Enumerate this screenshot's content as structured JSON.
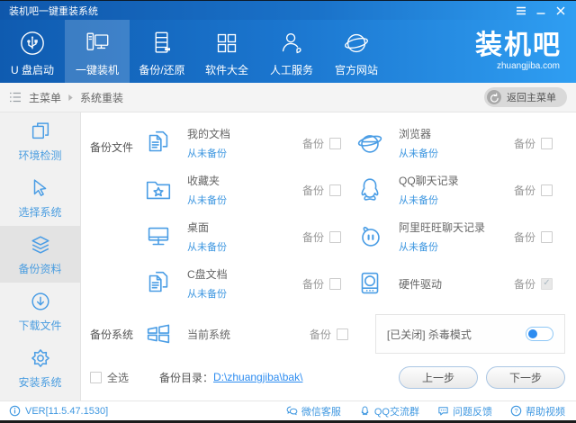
{
  "window": {
    "title": "装机吧一键重装系统",
    "controls": [
      {
        "id": "menu",
        "icon": "menu-icon"
      },
      {
        "id": "minimize",
        "icon": "minimize-icon"
      },
      {
        "id": "close",
        "icon": "close-icon"
      }
    ]
  },
  "nav": {
    "items": [
      {
        "id": "usb-boot",
        "icon": "usb-icon",
        "label": "U 盘启动",
        "active": false
      },
      {
        "id": "one-key-install",
        "icon": "computer-icon",
        "label": "一键装机",
        "active": true
      },
      {
        "id": "backup-restore",
        "icon": "server-icon",
        "label": "备份/还原",
        "active": false
      },
      {
        "id": "software-collection",
        "icon": "grid-icon",
        "label": "软件大全",
        "active": false
      },
      {
        "id": "human-service",
        "icon": "person-icon",
        "label": "人工服务",
        "active": false
      },
      {
        "id": "official-website",
        "icon": "globe-icon",
        "label": "官方网站",
        "active": false
      }
    ],
    "logo": {
      "text": "装机吧",
      "domain": "zhuangjiba.com"
    }
  },
  "breadcrumb": {
    "root": "主菜单",
    "current": "系统重装",
    "back_label": "返回主菜单"
  },
  "sidebar": {
    "items": [
      {
        "id": "env-check",
        "icon": "frames-icon",
        "label": "环境检测",
        "active": false
      },
      {
        "id": "select-system",
        "icon": "cursor-icon",
        "label": "选择系统",
        "active": false
      },
      {
        "id": "backup-data",
        "icon": "layers-icon",
        "label": "备份资料",
        "active": true
      },
      {
        "id": "download-files",
        "icon": "download-icon",
        "label": "下载文件",
        "active": false
      },
      {
        "id": "install-system",
        "icon": "gear-icon",
        "label": "安装系统",
        "active": false
      }
    ]
  },
  "main": {
    "backup_files_label": "备份文件",
    "backup_system_label": "备份系统",
    "backup_checkbox_label": "备份",
    "files": [
      {
        "icon": "documents-icon",
        "label": "我的文档",
        "status": "从未备份",
        "checked": false,
        "disabled": false
      },
      {
        "icon": "browser-icon",
        "label": "浏览器",
        "status": "从未备份",
        "checked": false,
        "disabled": false
      },
      {
        "icon": "folder-star-icon",
        "label": "收藏夹",
        "status": "从未备份",
        "checked": false,
        "disabled": false
      },
      {
        "icon": "qq-icon",
        "label": "QQ聊天记录",
        "status": "从未备份",
        "checked": false,
        "disabled": false
      },
      {
        "icon": "monitor-icon",
        "label": "桌面",
        "status": "从未备份",
        "checked": false,
        "disabled": false
      },
      {
        "icon": "wangwang-icon",
        "label": "阿里旺旺聊天记录",
        "status": "从未备份",
        "checked": false,
        "disabled": false
      },
      {
        "icon": "documents-icon",
        "label": "C盘文档",
        "status": "从未备份",
        "checked": false,
        "disabled": false
      },
      {
        "icon": "drive-icon",
        "label": "硬件驱动",
        "status": "",
        "checked": true,
        "disabled": true
      }
    ],
    "system": {
      "icon": "windows-icon",
      "label": "当前系统",
      "checked": false
    },
    "antivirus": {
      "label": "[已关闭] 杀毒模式",
      "enabled": false
    },
    "select_all_label": "全选",
    "backup_dir_label": "备份目录：",
    "backup_dir": "D:\\zhuangjiba\\bak\\",
    "prev_label": "上一步",
    "next_label": "下一步"
  },
  "footer": {
    "version": "VER[11.5.47.1530]",
    "links": [
      {
        "id": "wechat-service",
        "icon": "wechat-icon",
        "label": "微信客服"
      },
      {
        "id": "qq-group",
        "icon": "qq-small-icon",
        "label": "QQ交流群"
      },
      {
        "id": "feedback",
        "icon": "feedback-icon",
        "label": "问题反馈"
      },
      {
        "id": "help-video",
        "icon": "help-icon",
        "label": "帮助视频"
      }
    ]
  },
  "colors": {
    "accent": "#2d8cf0",
    "icon_blue": "#4a9de5",
    "nav_gradient_start": "#0f5bb0",
    "nav_gradient_end": "#2f9ef2",
    "sidebar_bg": "#f1f1f1",
    "sidebar_active_bg": "#e3e3e3"
  }
}
